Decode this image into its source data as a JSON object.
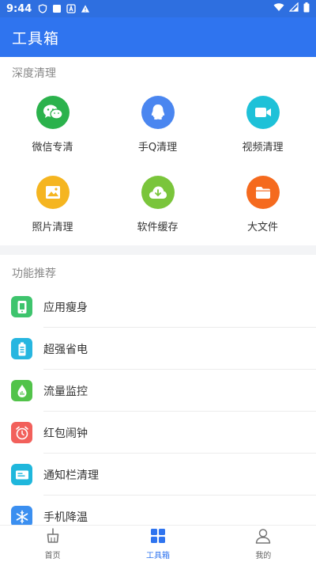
{
  "status_bar": {
    "time": "9:44"
  },
  "app_bar": {
    "title": "工具箱"
  },
  "deep_clean": {
    "title": "深度清理",
    "items": [
      {
        "label": "微信专清",
        "icon": "wechat-icon",
        "color": "#2bb24c"
      },
      {
        "label": "手Q清理",
        "icon": "qq-icon",
        "color": "#4a86f0"
      },
      {
        "label": "视频清理",
        "icon": "video-icon",
        "color": "#1ec1d8"
      },
      {
        "label": "照片清理",
        "icon": "photo-icon",
        "color": "#f5b520"
      },
      {
        "label": "软件缓存",
        "icon": "cloud-download-icon",
        "color": "#7ac53b"
      },
      {
        "label": "大文件",
        "icon": "folder-icon",
        "color": "#f56a1e"
      }
    ]
  },
  "recommend": {
    "title": "功能推荐",
    "items": [
      {
        "label": "应用瘦身",
        "icon": "phone-slim-icon",
        "color": "#3ec46d"
      },
      {
        "label": "超强省电",
        "icon": "battery-icon",
        "color": "#27b6e0"
      },
      {
        "label": "流量监控",
        "icon": "drop-icon",
        "color": "#52c34a"
      },
      {
        "label": "红包闹钟",
        "icon": "alarm-clock-icon",
        "color": "#f2605b"
      },
      {
        "label": "通知栏清理",
        "icon": "notification-card-icon",
        "color": "#1fb7dc"
      },
      {
        "label": "手机降温",
        "icon": "snowflake-icon",
        "color": "#3b8ff0"
      }
    ]
  },
  "tabs": [
    {
      "label": "首页",
      "icon": "home-broom-icon",
      "active": false
    },
    {
      "label": "工具箱",
      "icon": "toolbox-grid-icon",
      "active": true
    },
    {
      "label": "我的",
      "icon": "user-icon",
      "active": false
    }
  ],
  "colors": {
    "primary": "#2f74ef",
    "status_bar": "#2e6fe0"
  }
}
